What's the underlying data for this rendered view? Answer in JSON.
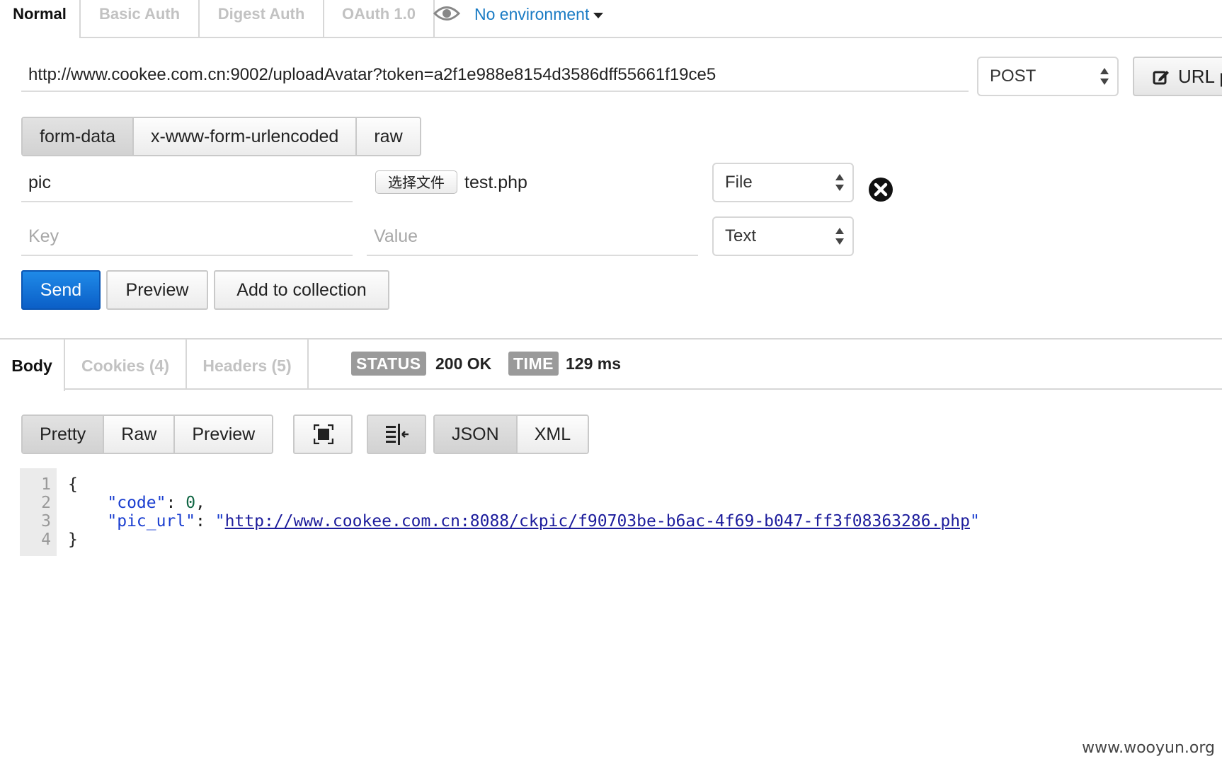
{
  "auth_tabs": [
    {
      "label": "Normal",
      "active": true
    },
    {
      "label": "Basic Auth",
      "active": false
    },
    {
      "label": "Digest Auth",
      "active": false
    },
    {
      "label": "OAuth 1.0",
      "active": false
    }
  ],
  "environment": {
    "label": "No environment"
  },
  "request": {
    "url": "http://www.cookee.com.cn:9002/uploadAvatar?token=a2f1e988e8154d3586dff55661f19ce5",
    "method": "POST",
    "url_params_label": "URL p"
  },
  "body_modes": [
    {
      "label": "form-data",
      "active": true
    },
    {
      "label": "x-www-form-urlencoded",
      "active": false
    },
    {
      "label": "raw",
      "active": false
    }
  ],
  "form_rows": [
    {
      "key": "pic",
      "choose_file_label": "选择文件",
      "file_name": "test.php",
      "type": "File"
    },
    {
      "key_placeholder": "Key",
      "value_placeholder": "Value",
      "type": "Text"
    }
  ],
  "actions": {
    "send": "Send",
    "preview": "Preview",
    "add_to_collection": "Add to collection"
  },
  "response_tabs": [
    {
      "label": "Body",
      "active": true
    },
    {
      "label": "Cookies (4)",
      "active": false
    },
    {
      "label": "Headers (5)",
      "active": false
    }
  ],
  "status": {
    "label": "STATUS",
    "value": "200 OK"
  },
  "time": {
    "label": "TIME",
    "value": "129 ms"
  },
  "view_modes": [
    {
      "label": "Pretty",
      "active": true
    },
    {
      "label": "Raw",
      "active": false
    },
    {
      "label": "Preview",
      "active": false
    }
  ],
  "format_modes": [
    {
      "label": "JSON",
      "active": true
    },
    {
      "label": "XML",
      "active": false
    }
  ],
  "response_code": {
    "line_numbers": [
      "1",
      "2",
      "3",
      "4"
    ],
    "open_brace": "{",
    "close_brace": "}",
    "code_key": "\"code\"",
    "code_value": "0",
    "pic_url_key": "\"pic_url\"",
    "pic_url_value": "http://www.cookee.com.cn:8088/ckpic/f90703be-b6ac-4f69-b047-ff3f08363286.php"
  },
  "watermark": "www.wooyun.org"
}
